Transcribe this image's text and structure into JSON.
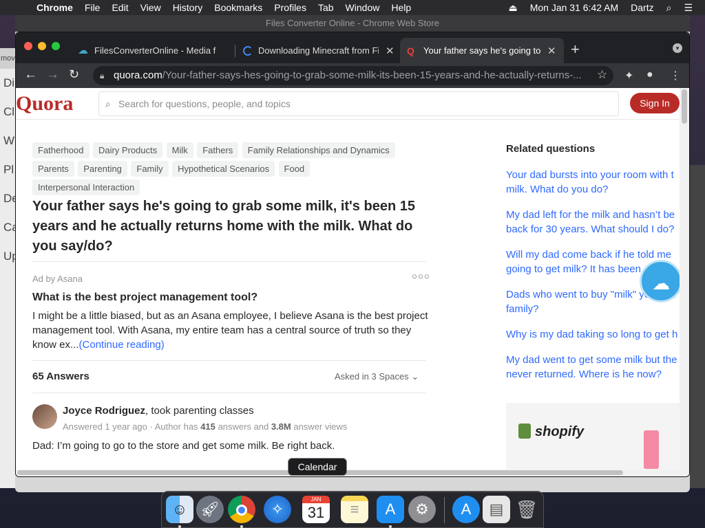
{
  "menubar": {
    "app": "Chrome",
    "items": [
      "File",
      "Edit",
      "View",
      "History",
      "Bookmarks",
      "Profiles",
      "Tab",
      "Window",
      "Help"
    ],
    "datetime": "Mon Jan 31  6:42 AM",
    "user": "Dartz"
  },
  "background_window": {
    "title": "Files Converter Online - Chrome Web Store"
  },
  "left_strip": {
    "file": "mov",
    "letters": [
      "Di",
      "Cl",
      "W",
      "Pl",
      "De",
      "Ca",
      "Up"
    ]
  },
  "tabs": [
    {
      "label": "FilesConverterOnline - Media f",
      "icon": "cloud-icon",
      "color": "#42a5c6"
    },
    {
      "label": "Downloading Minecraft from Fi",
      "icon": "loading-icon",
      "color": "#4285f4"
    },
    {
      "label": "Your father says he's going to",
      "icon": "quora-icon",
      "color": "#b92b27"
    }
  ],
  "omnibox": {
    "host": "quora.com",
    "path": "/Your-father-says-hes-going-to-grab-some-milk-its-been-15-years-and-he-actually-returns-..."
  },
  "quora": {
    "logo": "Quora",
    "search_placeholder": "Search for questions, people, and topics",
    "signin": "Sign In",
    "topics": [
      "Fatherhood",
      "Dairy Products",
      "Milk",
      "Fathers",
      "Family Relationships and Dynamics",
      "Parents",
      "Parenting",
      "Family",
      "Hypothetical Scenarios",
      "Food",
      "Interpersonal Interaction"
    ],
    "question_title": "Your father says he's going to grab some milk, it's been 15 years and he actually returns home with the milk. What do you say/do?",
    "ad": {
      "label": "Ad by Asana",
      "title": "What is the best project management tool?",
      "body": "I might be a little biased, but as an Asana employee, I believe Asana is the best project management tool. With Asana, my entire team has a central source of truth so they know ex...",
      "more": "(Continue reading)"
    },
    "answers_count": "65 Answers",
    "asked_in": "Asked in 3 Spaces",
    "answer": {
      "author": "Joyce Rodriguez",
      "credential": ", took parenting classes",
      "meta_prefix": "Answered 1 year ago · Author has ",
      "answers_num": "415",
      "meta_mid": " answers and ",
      "views_num": "3.8M",
      "meta_suffix": " answer views",
      "text": "Dad: I’m going to go to the store and get some milk. Be right back."
    },
    "related_heading": "Related questions",
    "related": [
      "Your dad bursts into your room with t milk. What do you do?",
      "My dad left for the milk and hasn’t be back for 30 years. What should I do?",
      "Will my dad come back if he told me going to get milk? It has been",
      "Dads who went to buy \"milk\" your old family?",
      "Why is my dad taking so long to get h",
      "My dad went to get some milk but the never returned. Where is he now?"
    ],
    "shopify": "shopify"
  },
  "dock": {
    "tooltip": "Calendar",
    "calendar_month": "JAN",
    "calendar_day": "31",
    "apps": [
      "finder-icon",
      "launchpad-icon",
      "chrome-icon",
      "safari-icon",
      "calendar-icon",
      "notes-icon",
      "app-store-icon",
      "system-preferences-icon",
      "app-store-folder-icon",
      "document-icon",
      "trash-icon"
    ]
  }
}
